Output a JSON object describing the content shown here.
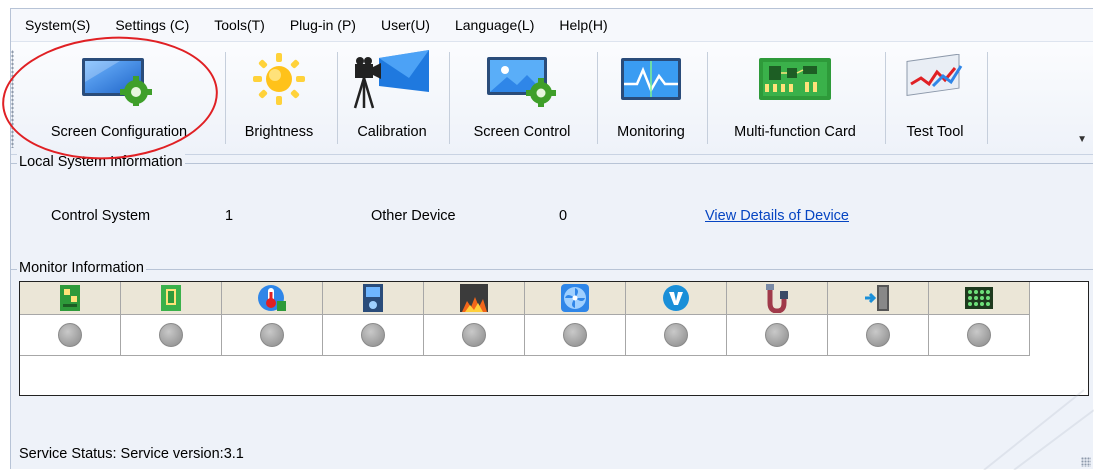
{
  "menubar": {
    "items": [
      "System(S)",
      "Settings (C)",
      "Tools(T)",
      "Plug-in (P)",
      "User(U)",
      "Language(L)",
      "Help(H)"
    ]
  },
  "toolbar": {
    "tools": [
      {
        "label": "Screen Configuration",
        "icon": "screen-configuration-icon"
      },
      {
        "label": "Brightness",
        "icon": "brightness-icon"
      },
      {
        "label": "Calibration",
        "icon": "calibration-icon"
      },
      {
        "label": "Screen Control",
        "icon": "screen-control-icon"
      },
      {
        "label": "Monitoring",
        "icon": "monitoring-icon"
      },
      {
        "label": "Multi-function Card",
        "icon": "multi-function-card-icon"
      },
      {
        "label": "Test Tool",
        "icon": "test-tool-icon"
      }
    ]
  },
  "local_system": {
    "title": "Local System Information",
    "control_system_label": "Control System",
    "control_system_value": "1",
    "other_device_label": "Other Device",
    "other_device_value": "0",
    "details_link": "View Details of Device"
  },
  "monitor": {
    "title": "Monitor Information",
    "columns": [
      {
        "icon": "receiving-card-icon"
      },
      {
        "icon": "module-card-icon"
      },
      {
        "icon": "temperature-icon"
      },
      {
        "icon": "control-card-icon"
      },
      {
        "icon": "smoke-icon"
      },
      {
        "icon": "fan-icon"
      },
      {
        "icon": "voltage-icon"
      },
      {
        "icon": "cable-icon"
      },
      {
        "icon": "door-icon"
      },
      {
        "icon": "module-grid-icon"
      }
    ],
    "status_color": "#a0a0a0"
  },
  "status": {
    "text": "Service Status:  Service version:3.1"
  },
  "colors": {
    "annotation_circle": "#e02024",
    "link": "#0645c2",
    "header_row": "#ebe6d7"
  }
}
